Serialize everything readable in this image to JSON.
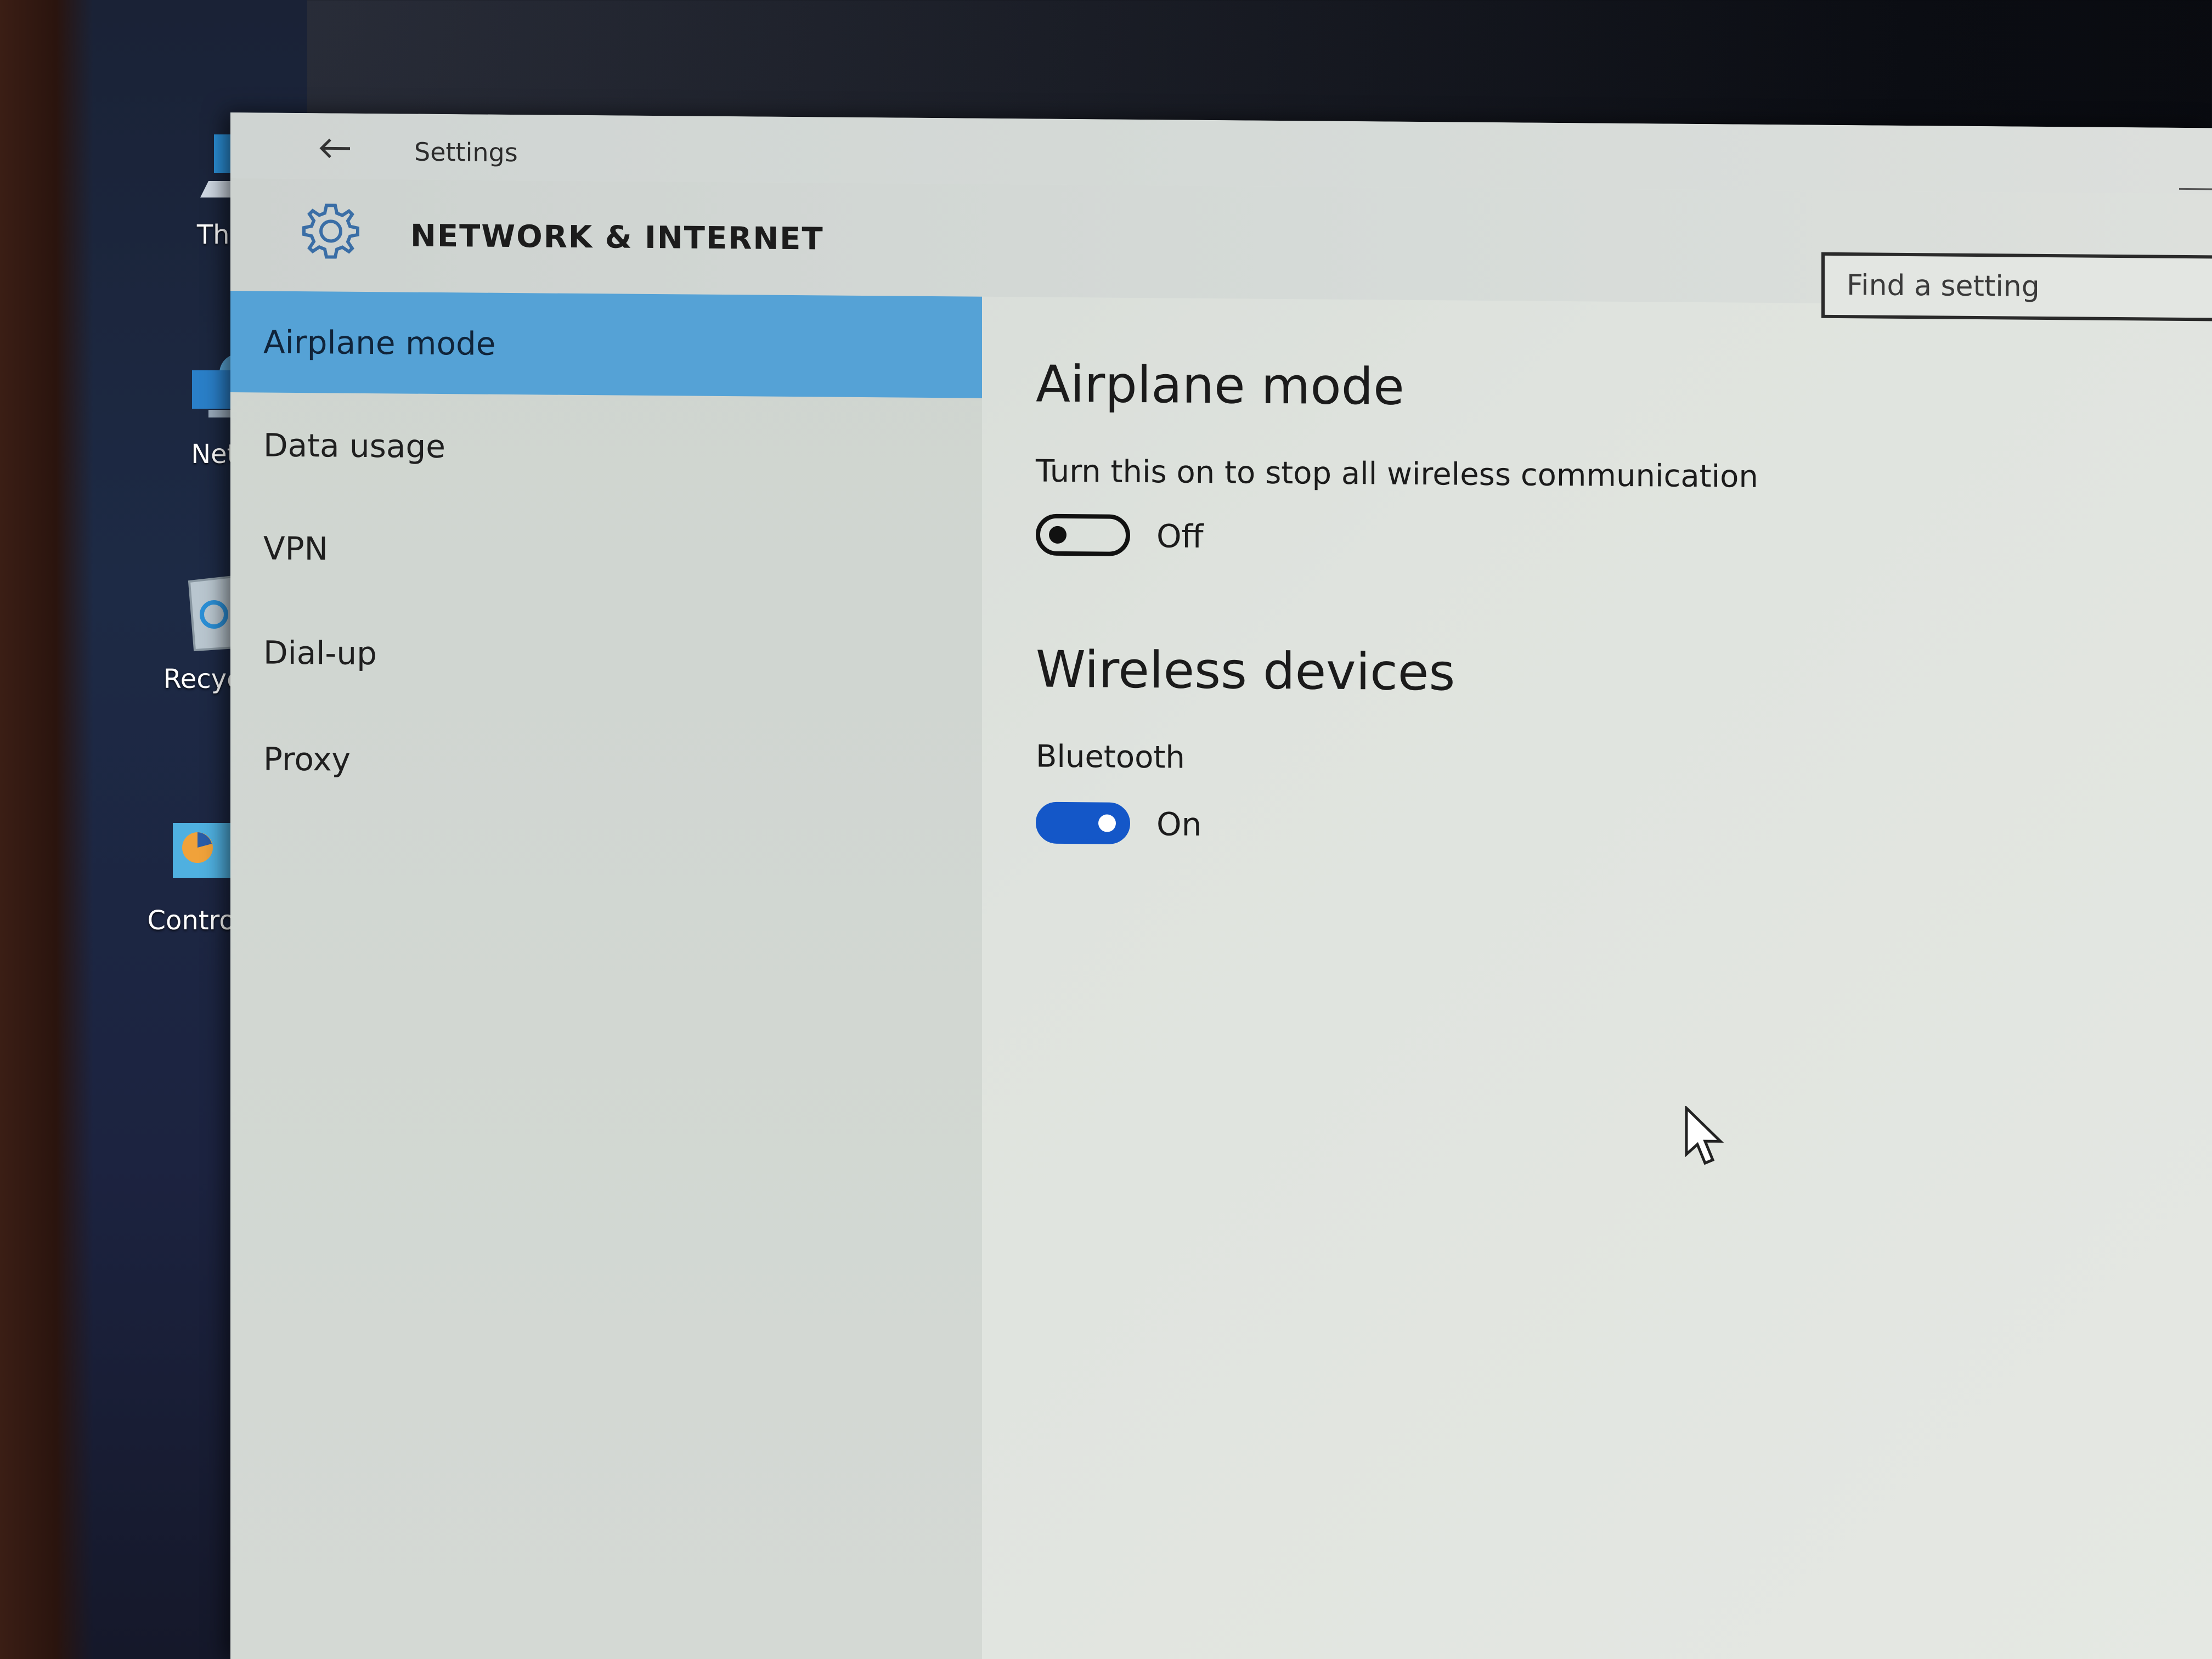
{
  "desktop": {
    "icons": [
      {
        "label": "This P"
      },
      {
        "label": "Netw"
      },
      {
        "label": "Recycle"
      },
      {
        "label": "Control I"
      }
    ]
  },
  "window": {
    "title": "Settings",
    "header": {
      "title": "NETWORK & INTERNET"
    },
    "search": {
      "placeholder": "Find a setting"
    }
  },
  "sidebar": {
    "items": [
      {
        "label": "Airplane mode",
        "selected": true
      },
      {
        "label": "Data usage"
      },
      {
        "label": "VPN"
      },
      {
        "label": "Dial-up"
      },
      {
        "label": "Proxy"
      }
    ]
  },
  "content": {
    "airplane": {
      "title": "Airplane mode",
      "description": "Turn this on to stop all wireless communication",
      "state": "Off"
    },
    "wireless": {
      "title": "Wireless devices",
      "bluetooth": {
        "label": "Bluetooth",
        "state": "On"
      }
    }
  },
  "colors": {
    "accent": "#55a2d6",
    "toggle_on": "#1457c8"
  },
  "icons": [
    "back-arrow-icon",
    "gear-icon",
    "this-pc-icon",
    "network-icon",
    "recycle-bin-icon",
    "control-panel-icon",
    "mouse-cursor-icon"
  ]
}
